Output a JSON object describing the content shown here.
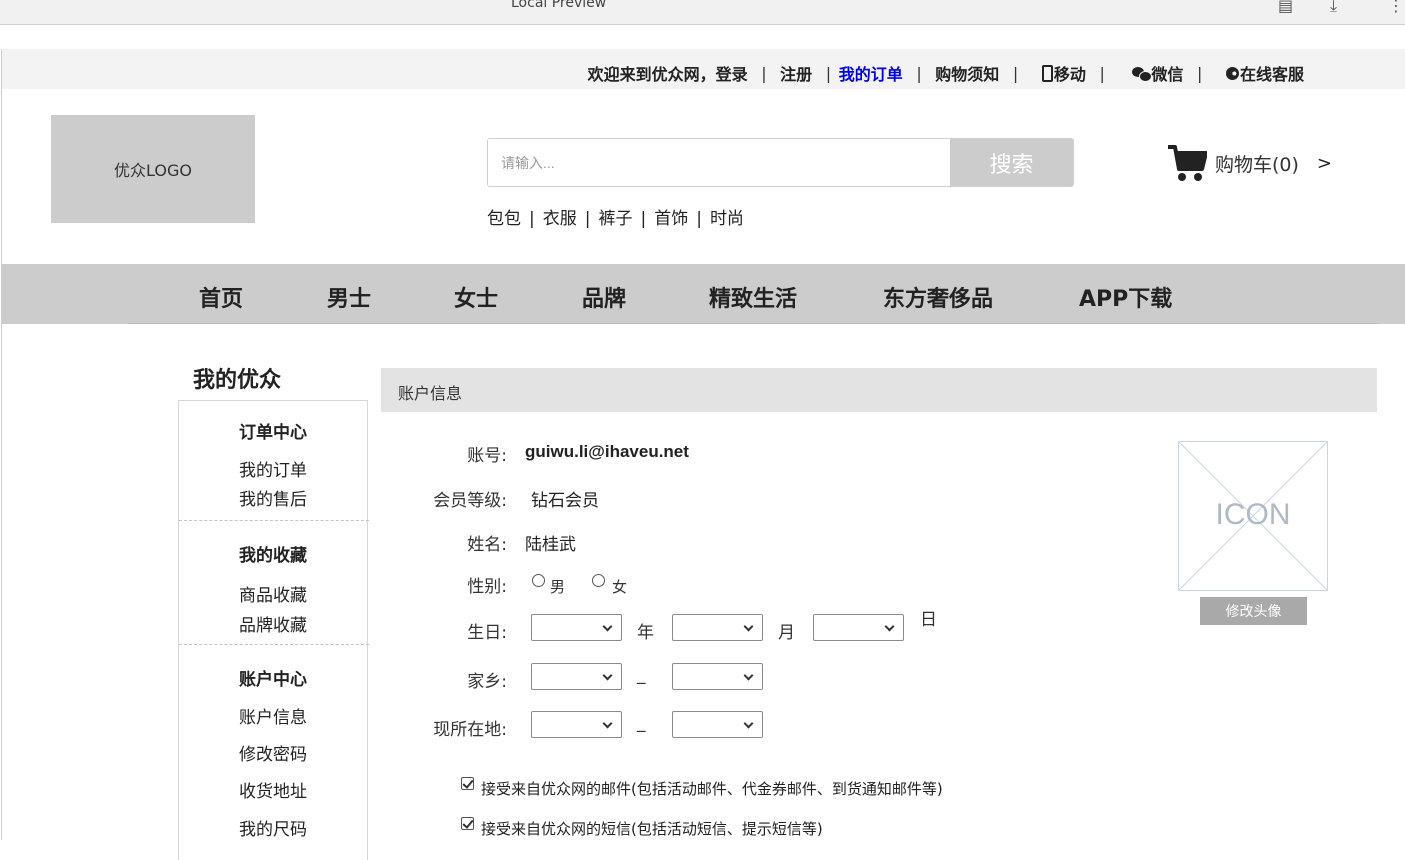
{
  "browser": {
    "title": "Local Preview"
  },
  "topbar": {
    "welcome": "欢迎来到优众网，",
    "login": "登录",
    "register": "注册",
    "my_orders": "我的订单",
    "shopping_guide": "购物须知",
    "mobile": "移动",
    "wechat": "微信",
    "online_service": "在线客服",
    "separator": "|"
  },
  "header": {
    "logo": "优众LOGO",
    "search_placeholder": "请输入...",
    "search_button": "搜索",
    "quick_links": [
      "包包",
      "衣服",
      "裤子",
      "首饰",
      "时尚"
    ],
    "quick_sep": "|",
    "cart_label": "购物车(0)",
    "cart_arrow": ">"
  },
  "nav": {
    "items": [
      "首页",
      "男士",
      "女士",
      "品牌",
      "精致生活",
      "东方奢侈品",
      "APP下载"
    ]
  },
  "sidebar": {
    "title": "我的优众",
    "groups": [
      {
        "title": "订单中心",
        "items": [
          "我的订单",
          "我的售后"
        ]
      },
      {
        "title": "我的收藏",
        "items": [
          "商品收藏",
          "品牌收藏"
        ]
      },
      {
        "title": "账户中心",
        "items": [
          "账户信息",
          "修改密码",
          "收货地址",
          "我的尺码"
        ]
      }
    ]
  },
  "content": {
    "header": "账户信息",
    "account_label": "账号:",
    "account_value": "guiwu.li@ihaveu.net",
    "level_label": "会员等级:",
    "level_value": "钻石会员",
    "name_label": "姓名:",
    "name_value": "陆桂武",
    "gender_label": "性别:",
    "gender_male": "男",
    "gender_female": "女",
    "birthday_label": "生日:",
    "year": "年",
    "month": "月",
    "day": "日",
    "hometown_label": "家乡:",
    "residence_label": "现所在地:",
    "dash": "_",
    "email_opt": "接受来自优众网的邮件(包括活动邮件、代金券邮件、到货通知邮件等)",
    "sms_opt": "接受来自优众网的短信(包括活动短信、提示短信等)"
  },
  "avatar": {
    "icon_text": "ICON",
    "button": "修改头像"
  }
}
